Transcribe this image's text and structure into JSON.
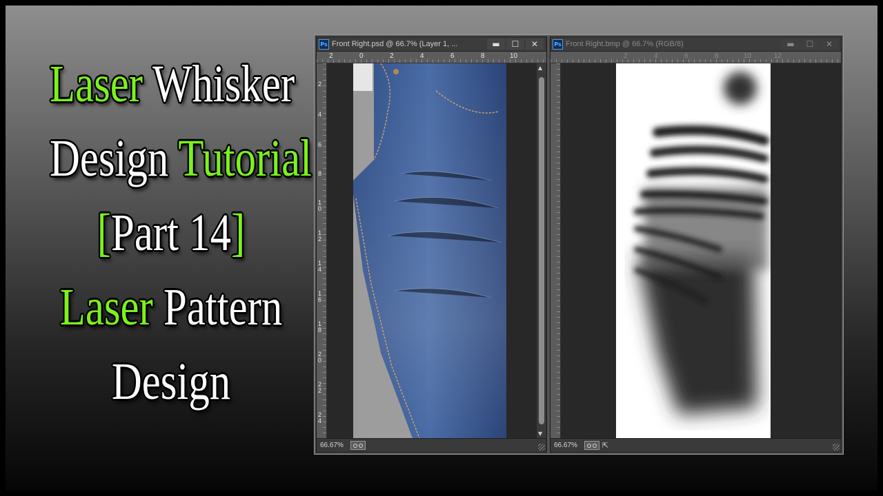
{
  "title_lines": [
    [
      {
        "text": "Laser",
        "color": "green"
      },
      {
        "text": " Whisker",
        "color": "white"
      }
    ],
    [
      {
        "text": "Design ",
        "color": "white"
      },
      {
        "text": "Tutorial",
        "color": "green"
      }
    ],
    [
      {
        "text": "[",
        "color": "green"
      },
      {
        "text": "Part 14",
        "color": "white"
      },
      {
        "text": "]",
        "color": "green"
      }
    ],
    [
      {
        "text": "Laser",
        "color": "green"
      },
      {
        "text": " Pattern",
        "color": "white"
      }
    ],
    [
      {
        "text": "Design",
        "color": "white"
      }
    ]
  ],
  "colors": {
    "green": "#7cf21b",
    "white": "#ffffff"
  },
  "left_doc": {
    "app_icon": "Ps",
    "title": "Front Right.psd @ 66.7% (Layer 1, ...",
    "minimize": "▬",
    "maximize": "☐",
    "close": "✕",
    "ruler_h": [
      "2",
      "0",
      "2",
      "4",
      "6",
      "8",
      "10"
    ],
    "ruler_v": [
      "2",
      "4",
      "6",
      "8",
      "10",
      "12",
      "14",
      "16",
      "18",
      "20",
      "22",
      "24"
    ],
    "zoom": "66.67%",
    "image": "denim-jeans-front-right-photo"
  },
  "right_doc": {
    "app_icon": "Ps",
    "title": "Front Right.bmp @ 66.7% (RGB/8)",
    "minimize": "▬",
    "maximize": "☐",
    "close": "✕",
    "ruler_h": [
      "2",
      "4",
      "6",
      "8",
      "10",
      "12"
    ],
    "zoom": "66.67%",
    "image": "grayscale-laser-whisker-pattern"
  }
}
